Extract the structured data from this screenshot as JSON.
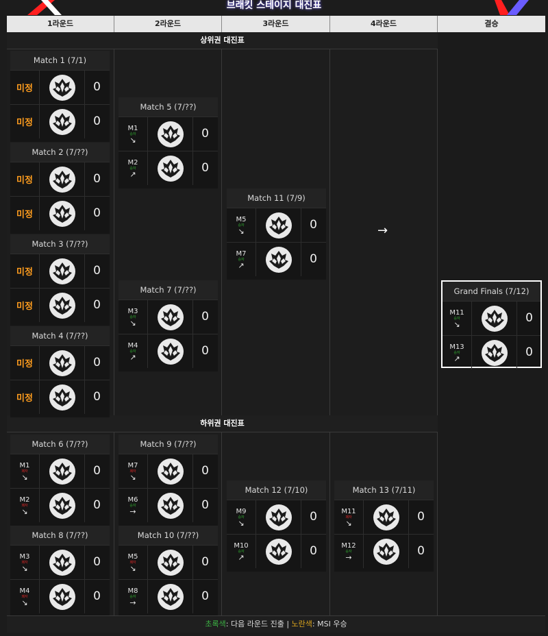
{
  "title": "브래킷 스테이지 대진표",
  "rounds": [
    "1라운드",
    "2라운드",
    "3라운드",
    "4라운드",
    "결승"
  ],
  "sections": {
    "upper": "상위권 대진표",
    "lower": "하위권 대진표"
  },
  "icons": {
    "team_logo": "team-crest-icon"
  },
  "colors": {
    "pending": "#ff9d1e",
    "win": "#2fa82f",
    "lose": "#d82626",
    "accent": "#6a5cff",
    "deco_red": "#ff1f1f"
  },
  "arrow_glyph": "→",
  "matches": {
    "m1": {
      "title": "Match 1 (7/1)",
      "rows": [
        {
          "pending": "미정",
          "score": "0"
        },
        {
          "pending": "미정",
          "score": "0"
        }
      ]
    },
    "m2": {
      "title": "Match 2 (7/??)",
      "rows": [
        {
          "pending": "미정",
          "score": "0"
        },
        {
          "pending": "미정",
          "score": "0"
        }
      ]
    },
    "m3": {
      "title": "Match 3 (7/??)",
      "rows": [
        {
          "pending": "미정",
          "score": "0"
        },
        {
          "pending": "미정",
          "score": "0"
        }
      ]
    },
    "m4": {
      "title": "Match 4 (7/??)",
      "rows": [
        {
          "pending": "미정",
          "score": "0"
        },
        {
          "pending": "미정",
          "score": "0"
        }
      ]
    },
    "m5": {
      "title": "Match 5 (7/??)",
      "rows": [
        {
          "ref": "M1",
          "tag": "승자",
          "arrow": "↘",
          "score": "0"
        },
        {
          "ref": "M2",
          "tag": "승자",
          "arrow": "↗",
          "score": "0"
        }
      ]
    },
    "m7": {
      "title": "Match 7 (7/??)",
      "rows": [
        {
          "ref": "M3",
          "tag": "승자",
          "arrow": "↘",
          "score": "0"
        },
        {
          "ref": "M4",
          "tag": "승자",
          "arrow": "↗",
          "score": "0"
        }
      ]
    },
    "m11": {
      "title": "Match 11 (7/9)",
      "rows": [
        {
          "ref": "M5",
          "tag": "승자",
          "arrow": "↘",
          "score": "0"
        },
        {
          "ref": "M7",
          "tag": "승자",
          "arrow": "↗",
          "score": "0"
        }
      ]
    },
    "gf": {
      "title": "Grand Finals (7/12)",
      "rows": [
        {
          "ref": "M11",
          "tag": "승자",
          "arrow": "↘",
          "score": "0"
        },
        {
          "ref": "M13",
          "tag": "승자",
          "arrow": "↗",
          "score": "0"
        }
      ]
    },
    "m6": {
      "title": "Match 6 (7/??)",
      "rows": [
        {
          "ref": "M1",
          "tag": "패자",
          "arrow": "↘",
          "score": "0"
        },
        {
          "ref": "M2",
          "tag": "패자",
          "arrow": "↘",
          "score": "0"
        }
      ]
    },
    "m8": {
      "title": "Match 8 (7/??)",
      "rows": [
        {
          "ref": "M3",
          "tag": "패자",
          "arrow": "↘",
          "score": "0"
        },
        {
          "ref": "M4",
          "tag": "패자",
          "arrow": "↘",
          "score": "0"
        }
      ]
    },
    "m9": {
      "title": "Match 9 (7/??)",
      "rows": [
        {
          "ref": "M7",
          "tag": "패자",
          "arrow": "↘",
          "score": "0"
        },
        {
          "ref": "M6",
          "tag": "승자",
          "arrow": "→",
          "score": "0"
        }
      ]
    },
    "m10": {
      "title": "Match 10 (7/??)",
      "rows": [
        {
          "ref": "M5",
          "tag": "패자",
          "arrow": "↘",
          "score": "0"
        },
        {
          "ref": "M8",
          "tag": "승자",
          "arrow": "→",
          "score": "0"
        }
      ]
    },
    "m12": {
      "title": "Match 12 (7/10)",
      "rows": [
        {
          "ref": "M9",
          "tag": "승자",
          "arrow": "↘",
          "score": "0"
        },
        {
          "ref": "M10",
          "tag": "승자",
          "arrow": "↗",
          "score": "0"
        }
      ]
    },
    "m13": {
      "title": "Match 13 (7/11)",
      "rows": [
        {
          "ref": "M11",
          "tag": "패자",
          "arrow": "↘",
          "score": "0"
        },
        {
          "ref": "M12",
          "tag": "승자",
          "arrow": "→",
          "score": "0"
        }
      ]
    }
  },
  "legend": {
    "green_word": "초록색",
    "green_desc": ": 다음 라운드 진출 | ",
    "yellow_word": "노란색",
    "yellow_desc": ": MSI 우승"
  }
}
